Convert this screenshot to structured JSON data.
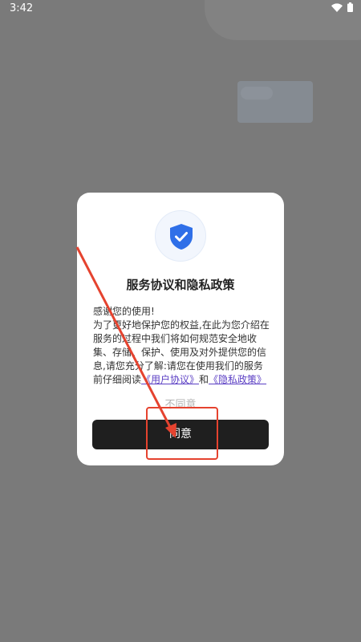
{
  "status_bar": {
    "time": "3:42",
    "icons": [
      "wifi-icon",
      "battery-icon"
    ]
  },
  "dialog": {
    "icon": "shield-check-icon",
    "title": "服务协议和隐私政策",
    "body_line_1": "感谢您的使用!",
    "body_line_2_prefix": "为了更好地保护您的权益,在此为您介绍在服务的过程中我们将如何规范安全地收集、存储、保护、使用及对外提供您的信息,请您充分了解:请您在使用我们的服务前仔细阅读",
    "user_agreement_link": "《用户协议》",
    "and_text": "和",
    "privacy_policy_link": "《隐私政策》",
    "disagree_label": "不同意",
    "agree_label": "同意"
  },
  "colors": {
    "scrim": "#7a7a7a",
    "dialog_bg": "#ffffff",
    "shield_blue": "#2f6fe8",
    "link_purple": "#5b3fc4",
    "agree_button_bg": "#1f1f1f",
    "annotation_red": "#e5432f"
  }
}
